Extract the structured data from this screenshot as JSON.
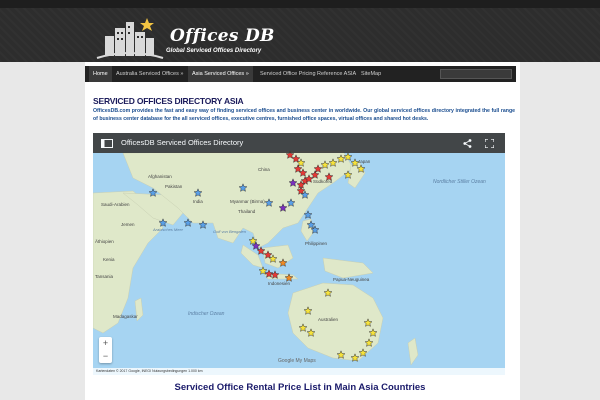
{
  "brand": {
    "title": "Offices DB",
    "subtitle": "Global Serviced Offices Directory"
  },
  "nav": {
    "items": [
      {
        "label": "Home",
        "active": true
      },
      {
        "label": "Australia Serviced Offices »",
        "active": false
      },
      {
        "label": "Asia Serviced Offices »",
        "active": true
      },
      {
        "label": "Serviced Office Pricing Reference ASIA",
        "active": false
      },
      {
        "label": "SiteMap",
        "active": false
      }
    ]
  },
  "content": {
    "section_title": "SERVICED OFFICES DIRECTORY ASIA",
    "intro": "OfficesDB.com provides the fast and easy way of finding serviced offices and business center in worldwide. Our global serviced offices directory integrated the full range of business center database for the all serviced offices, executive centres, furnished office spaces, virtual offices and shared hot desks.",
    "price_heading": "Serviced Office Rental Price List in Main Asia Countries"
  },
  "map": {
    "title": "OfficesDB Serviced Offices Directory",
    "footer": "Kartendaten © 2017 Google, INEGI   Nutzungsbedingungen   1.000 km",
    "attribution": "Google My Maps",
    "labels": {
      "china": "China",
      "afghanistan": "Afghanistan",
      "pakistan": "Pakistan",
      "india": "India",
      "saudi": "Saudi-Arabien",
      "jemen": "Jemen",
      "aethiopien": "Äthiopien",
      "kenia": "Kenia",
      "tansania": "Tansania",
      "madagaskar": "Madagaskar",
      "thailand": "Thailand",
      "myanmar": "Myanmar (Birma)",
      "indonesien": "Indonesien",
      "papua": "Papua-Neuguinea",
      "australien": "Australien",
      "philippinen": "Philippinen",
      "suedkorea": "Südkorea",
      "japan": "Japan",
      "pazifik": "Nordlicher Stiller Ozean",
      "indischer": "Indischer Ozean",
      "arabisches": "Arabisches Meer",
      "bengalen": "Golf von Bengalen"
    },
    "zoom_in": "+",
    "zoom_out": "−"
  },
  "colors": {
    "nav_bg": "#222222",
    "header_bg": "#2d2d2d",
    "title_color": "#1a1a5a",
    "intro_color": "#1a4d8f",
    "marker_red": "#e53935",
    "marker_yellow": "#f6e33c",
    "marker_blue": "#5aa0e8",
    "marker_purple": "#7b2fbf",
    "marker_orange": "#f08a24"
  }
}
